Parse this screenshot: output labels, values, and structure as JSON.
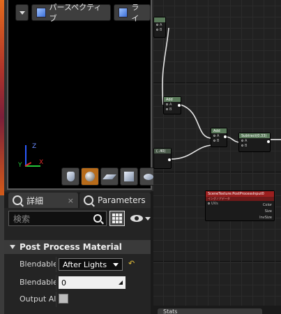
{
  "viewport": {
    "toolbar": {
      "perspective_label": "パースペクティブ",
      "lit_label": "ライ"
    },
    "axis": {
      "x": "X",
      "y": "Y",
      "z": "Z"
    },
    "preview_shapes": [
      "cylinder",
      "sphere",
      "plane",
      "cube",
      "teapot"
    ],
    "active_shape": "sphere"
  },
  "details": {
    "tabs": [
      {
        "label": "詳細",
        "close": "×"
      },
      {
        "label": "Parameters",
        "close": "×"
      }
    ],
    "search": {
      "placeholder": "検索"
    },
    "section_title": "Post Process Material",
    "properties": [
      {
        "label": "Blendable",
        "kind": "combo",
        "value": "After Lights",
        "reset": "↶"
      },
      {
        "label": "Blendable",
        "kind": "number",
        "value": "0"
      },
      {
        "label": "Output Alpha",
        "kind": "checkbox",
        "value": ""
      }
    ]
  },
  "graph": {
    "nodes": {
      "add_top": {
        "title": "Add",
        "pins": [
          "A",
          "B"
        ]
      },
      "add_mid": {
        "title": "Add",
        "pins": [
          "A",
          "B"
        ]
      },
      "subtract": {
        "title": "Subtract(0.33)",
        "pins": [
          "A",
          "B"
        ]
      },
      "scene_texture": {
        "title": "SceneTexture:PostProcessInput0",
        "subtitle": "イングノアデータ",
        "inputs": [
          "UVs"
        ],
        "outputs": [
          "Color",
          "Size",
          "InvSize"
        ]
      },
      "partial_top": {
        "title": "",
        "pins": [
          "A",
          "B"
        ]
      },
      "partial_left": {
        "title": "(..40)"
      }
    },
    "bottom_tab_label": "Stats"
  },
  "colors": {
    "accent": "#e58a1f",
    "scene_texture_header": "#9b1f1f",
    "math_header": "#5b7a5b"
  }
}
